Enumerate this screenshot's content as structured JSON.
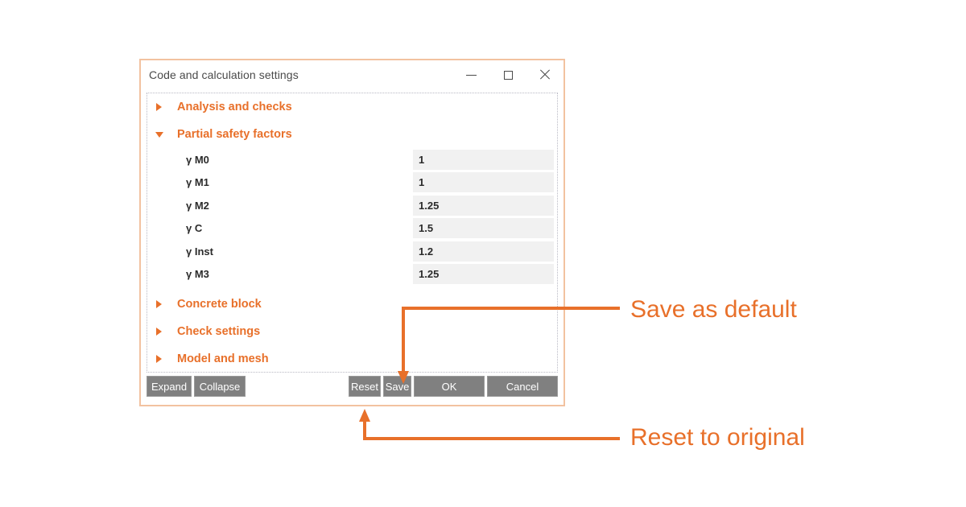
{
  "window": {
    "title": "Code and calculation settings",
    "controls": [
      {
        "name": "minimize",
        "label": "–"
      },
      {
        "name": "maximize",
        "label": "□"
      },
      {
        "name": "close",
        "label": "×"
      }
    ]
  },
  "accent_color": "#e8702a",
  "panel": {
    "groups": [
      {
        "label": "Analysis and checks",
        "expanded": false
      },
      {
        "label": "Partial safety factors",
        "expanded": true
      },
      {
        "label": "Concrete block",
        "expanded": false
      },
      {
        "label": "Check settings",
        "expanded": false
      },
      {
        "label": "Model and mesh",
        "expanded": false
      }
    ],
    "partial_safety_factors": [
      {
        "label": "γ M0",
        "value": "1"
      },
      {
        "label": "γ M1",
        "value": "1"
      },
      {
        "label": "γ M2",
        "value": "1.25"
      },
      {
        "label": "γ C",
        "value": "1.5"
      },
      {
        "label": "γ Inst",
        "value": "1.2"
      },
      {
        "label": "γ M3",
        "value": "1.25"
      }
    ]
  },
  "footer": {
    "expand": "Expand",
    "collapse": "Collapse",
    "reset": "Reset",
    "save": "Save",
    "ok": "OK",
    "cancel": "Cancel"
  },
  "annotations": {
    "save_as_default": "Save as default",
    "reset_to_original": "Reset to original"
  }
}
